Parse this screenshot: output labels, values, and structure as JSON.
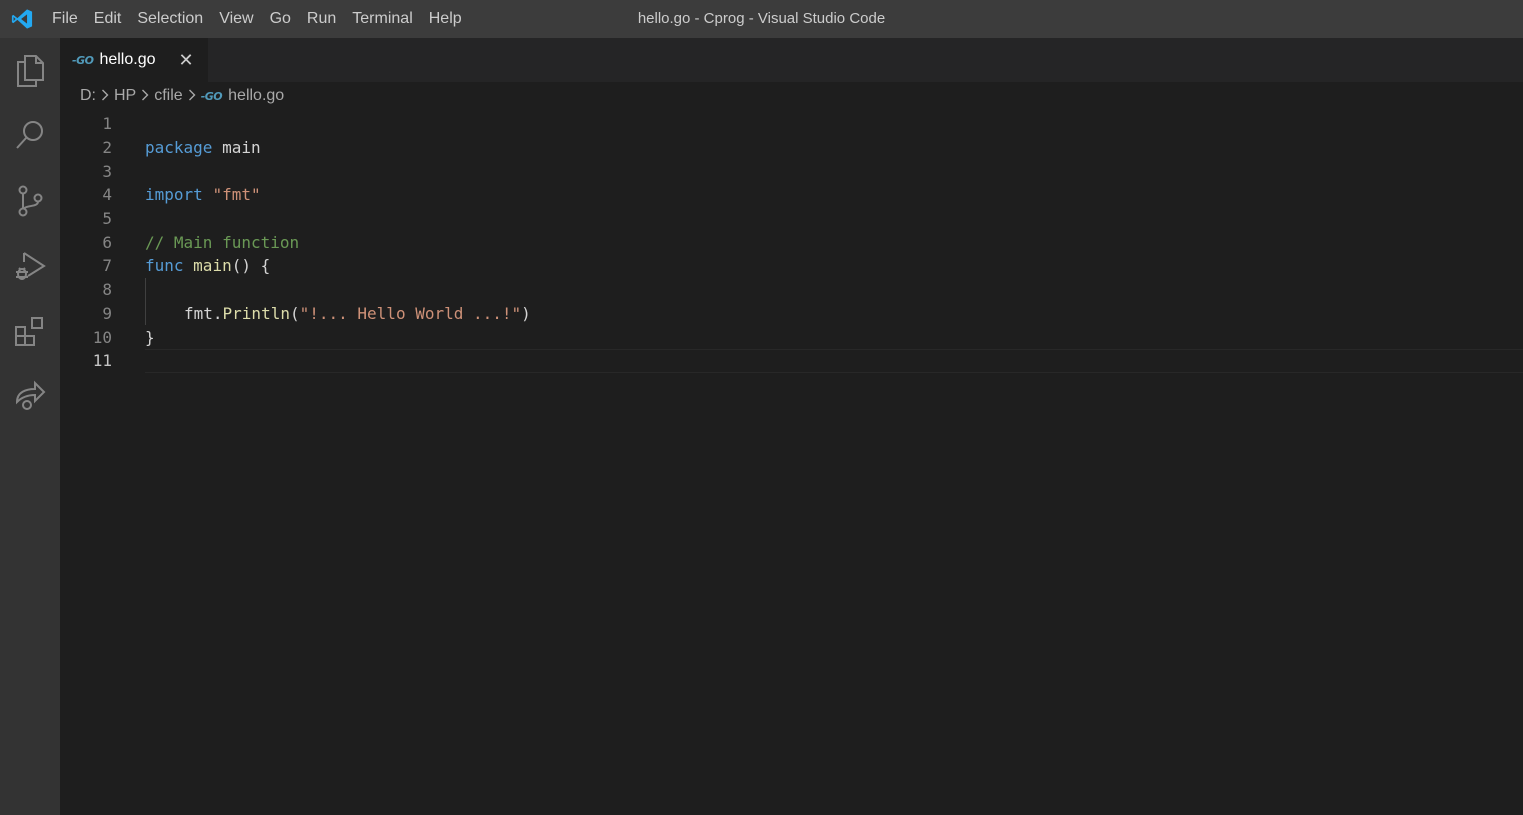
{
  "window": {
    "title": "hello.go - Cprog - Visual Studio Code"
  },
  "menu": [
    "File",
    "Edit",
    "Selection",
    "View",
    "Go",
    "Run",
    "Terminal",
    "Help"
  ],
  "activitybar": [
    {
      "name": "explorer-icon"
    },
    {
      "name": "search-icon"
    },
    {
      "name": "source-control-icon"
    },
    {
      "name": "run-debug-icon"
    },
    {
      "name": "extensions-icon"
    },
    {
      "name": "live-share-icon"
    }
  ],
  "tab": {
    "icon": "go-file-icon",
    "icon_text": "-GO",
    "label": "hello.go",
    "close": "✕"
  },
  "breadcrumb": {
    "items": [
      "D:",
      "HP",
      "cfile"
    ],
    "file_icon_text": "-GO",
    "file": "hello.go"
  },
  "editor": {
    "line_numbers": [
      "1",
      "2",
      "3",
      "4",
      "5",
      "6",
      "7",
      "8",
      "9",
      "10",
      "11"
    ],
    "active_line": "11",
    "lines": {
      "l2_kw": "package",
      "l2_rest": " main",
      "l4_kw": "import",
      "l4_str": "\"fmt\"",
      "l6_cmt": "// Main function",
      "l7_kw": "func",
      "l7_fn": "main",
      "l7_rest": "() {",
      "l9_obj": "fmt.",
      "l9_fn": "Println",
      "l9_open": "(",
      "l9_str": "\"!... Hello World ...!\"",
      "l9_close": ")",
      "l10": "}"
    }
  },
  "colors": {
    "keyword": "#569cd6",
    "string": "#ce9178",
    "comment": "#6a9955",
    "function": "#dcdcaa",
    "accent": "#007acc"
  }
}
